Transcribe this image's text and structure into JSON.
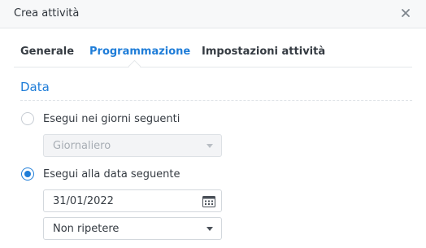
{
  "window": {
    "title": "Crea attività",
    "close_icon": "close-icon"
  },
  "tabs": [
    {
      "label": "Generale",
      "active": false
    },
    {
      "label": "Programmazione",
      "active": true
    },
    {
      "label": "Impostazioni attività",
      "active": false
    }
  ],
  "section": {
    "title": "Data"
  },
  "options": [
    {
      "label": "Esegui nei giorni seguenti",
      "checked": false
    },
    {
      "label": "Esegui alla data seguente",
      "checked": true
    }
  ],
  "fields": {
    "frequency": {
      "value": "Giornaliero",
      "disabled": true
    },
    "date": {
      "value": "31/01/2022",
      "icon": "calendar-icon"
    },
    "repeat": {
      "value": "Non ripetere",
      "disabled": false
    }
  },
  "colors": {
    "accent": "#1f7dd8",
    "text": "#353b42",
    "disabled_text": "#a7adb4",
    "border": "#d3d8dd"
  }
}
